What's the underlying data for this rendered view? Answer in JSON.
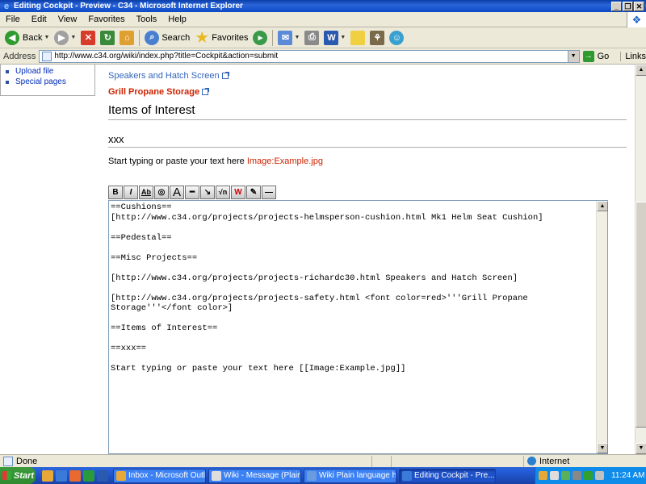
{
  "window": {
    "title": "Editing Cockpit - Preview - C34 - Microsoft Internet Explorer",
    "controls": [
      "_",
      "❒",
      "✕"
    ]
  },
  "menu": [
    "File",
    "Edit",
    "View",
    "Favorites",
    "Tools",
    "Help"
  ],
  "toolbar": {
    "back_label": "Back",
    "search_label": "Search",
    "favorites_label": "Favorites"
  },
  "address": {
    "label": "Address",
    "url": "http://www.c34.org/wiki/index.php?title=Cockpit&action=submit",
    "go_label": "Go",
    "links_label": "Links"
  },
  "sidebar": {
    "items": [
      {
        "label": "Upload file"
      },
      {
        "label": "Special pages"
      }
    ]
  },
  "preview": {
    "link1": "Speakers and Hatch Screen",
    "link2": "Grill Propane Storage",
    "heading1": "Items of Interest",
    "heading2": "xxx",
    "para_text": "Start typing or paste your text here ",
    "para_link": "Image:Example.jpg"
  },
  "edit_buttons": [
    "B",
    "I",
    "Ab",
    "◎",
    "A",
    "━",
    "↘",
    "√n",
    "W",
    "✎",
    "—"
  ],
  "editor": {
    "content": "==Cushions==\n[http://www.c34.org/projects/projects-helmsperson-cushion.html Mk1 Helm Seat Cushion]\n\n==Pedestal==\n\n==Misc Projects==\n\n[http://www.c34.org/projects/projects-richardc30.html Speakers and Hatch Screen]\n\n[http://www.c34.org/projects/projects-safety.html <font color=red>'''Grill Propane\nStorage'''</font color>]\n\n==Items of Interest==\n\n==xxx==\n\nStart typing or paste your text here [[Image:Example.jpg]]"
  },
  "status": {
    "text": "Done",
    "zone": "Internet"
  },
  "taskbar": {
    "start_label": "Start",
    "tasks": [
      {
        "label": "Inbox - Microsoft Outlook"
      },
      {
        "label": "Wiki - Message (Plain T..."
      },
      {
        "label": "Wiki Plain language ho..."
      },
      {
        "label": "Editing Cockpit - Pre..."
      }
    ],
    "clock": "11:24 AM"
  }
}
